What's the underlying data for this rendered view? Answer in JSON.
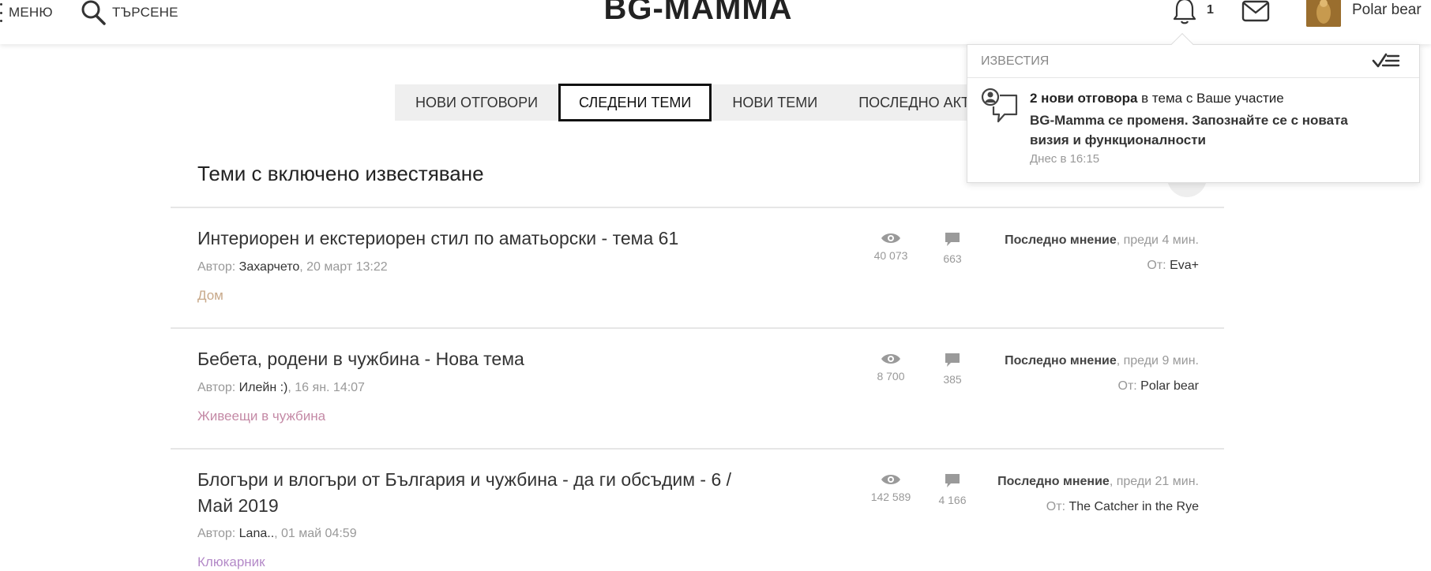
{
  "header": {
    "menu_label": "МЕНЮ",
    "search_label": "ТЪРСЕНЕ",
    "logo_text": "BG-MAMMA",
    "notif_count": "1",
    "user_name": "Polar bear"
  },
  "tabs": [
    {
      "label": "НОВИ ОТГОВОРИ",
      "active": false
    },
    {
      "label": "СЛЕДЕНИ ТЕМИ",
      "active": true
    },
    {
      "label": "НОВИ ТЕМИ",
      "active": false
    },
    {
      "label": "ПОСЛЕДНО АКТИВН",
      "active": false
    }
  ],
  "section_title": "Теми с включено известяване",
  "topics": [
    {
      "title": "Интериорен и екстериорен стил по аматьорски - тема 61",
      "author_prefix": "Автор: ",
      "author": "Захарчето",
      "date": ", 20 март 13:22",
      "category": "Дом",
      "views": "40 073",
      "replies": "663",
      "last_label": "Последно мнение",
      "last_time": ", преди 4 мин.",
      "last_by_prefix": "От: ",
      "last_by": "Eva+"
    },
    {
      "title": "Бебета, родени в чужбина - Нова тема",
      "author_prefix": "Автор: ",
      "author": "Илейн :)",
      "date": ", 16 ян. 14:07",
      "category": "Живеещи в чужбина",
      "views": "8 700",
      "replies": "385",
      "last_label": "Последно мнение",
      "last_time": ", преди 9 мин.",
      "last_by_prefix": "От: ",
      "last_by": "Polar bear"
    },
    {
      "title": "Блогъри и влогъри от България и чужбина - да ги обсъдим - 6 / Май 2019",
      "author_prefix": "Автор: ",
      "author": "Lana..",
      "date": ", 01 май 04:59",
      "category": "Клюкарник",
      "views": "142 589",
      "replies": "4 166",
      "last_label": "Последно мнение",
      "last_time": ", преди 21 мин.",
      "last_by_prefix": "От: ",
      "last_by": "The Catcher in the Rye"
    }
  ],
  "category_colors": {
    "home": "#c8a98a",
    "abroad": "#c48aa6",
    "gossip": "#b48ac8"
  },
  "notifications": {
    "title": "ИЗВЕСТИЯ",
    "item": {
      "count_text": "2 нови отговора",
      "rest_text": " в тема с Ваше участие",
      "topic": "BG-Mamma се променя. Запознайте се с новата визия и функционалности",
      "time": "Днес в 16:15"
    }
  }
}
